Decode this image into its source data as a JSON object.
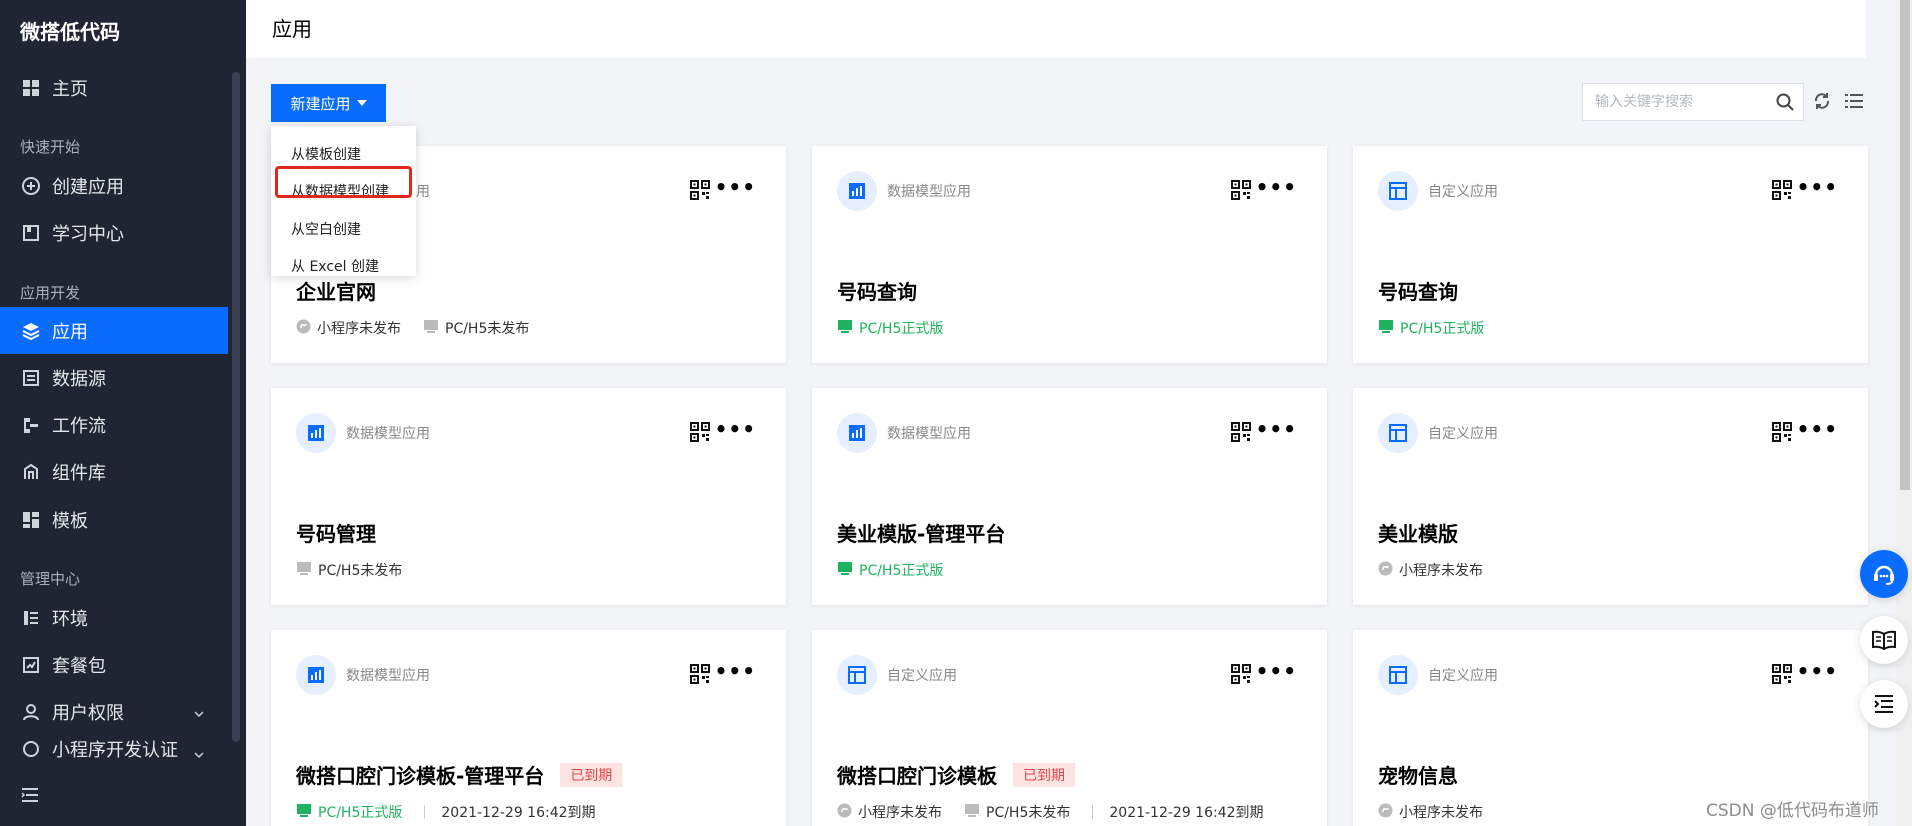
{
  "sidebar": {
    "brand": "微搭低代码",
    "home": "主页",
    "sections": {
      "quick_start": "快速开始",
      "app_dev": "应用开发",
      "admin": "管理中心"
    },
    "items": {
      "create_app": "创建应用",
      "learning": "学习中心",
      "apps": "应用",
      "datasource": "数据源",
      "workflow": "工作流",
      "components": "组件库",
      "templates": "模板",
      "env": "环境",
      "package": "套餐包",
      "user_perm": "用户权限",
      "mini_cert": "小程序开发认证"
    }
  },
  "header": {
    "title": "应用"
  },
  "toolbar": {
    "new_app_label": "新建应用",
    "search_placeholder": "输入关键字搜索"
  },
  "dropdown": {
    "items": [
      "从模板创建",
      "从数据模型创建",
      "从空白创建",
      "从 Excel 创建"
    ],
    "highlighted_index": 1
  },
  "cards": [
    {
      "type_label": "数据模型应用",
      "name": "企业官网",
      "s1": "小程序未发布",
      "s2": "PC/H5未发布"
    },
    {
      "type_label": "数据模型应用",
      "name": "号码查询",
      "s1": "PC/H5正式版"
    },
    {
      "type_label": "自定义应用",
      "name": "号码查询",
      "s1": "PC/H5正式版"
    },
    {
      "type_label": "数据模型应用",
      "name": "号码管理",
      "s1": "PC/H5未发布"
    },
    {
      "type_label": "数据模型应用",
      "name": "美业模版-管理平台",
      "s1": "PC/H5正式版"
    },
    {
      "type_label": "自定义应用",
      "name": "美业模版",
      "s1": "小程序未发布"
    },
    {
      "type_label": "数据模型应用",
      "name": "微搭口腔门诊模板-管理平台",
      "expired": "已到期",
      "s1": "PC/H5正式版",
      "date": "2021-12-29 16:42到期"
    },
    {
      "type_label": "自定义应用",
      "name": "微搭口腔门诊模板",
      "expired": "已到期",
      "s1": "小程序未发布",
      "s2": "PC/H5未发布",
      "date": "2021-12-29 16:42到期"
    },
    {
      "type_label": "自定义应用",
      "name": "宠物信息",
      "s1": "小程序未发布"
    }
  ],
  "watermark": "CSDN @低代码布道师",
  "colors": {
    "primary": "#0a6cff",
    "sidebar_bg": "#1f2532",
    "published_green": "#1fb35f",
    "expired_red": "#e54545"
  }
}
